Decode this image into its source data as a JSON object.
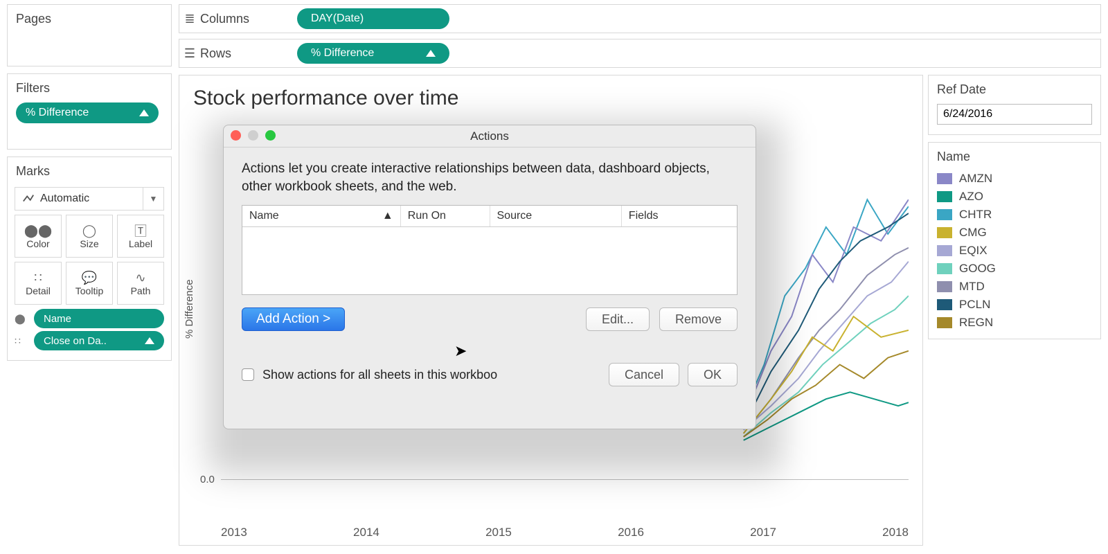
{
  "pages": {
    "title": "Pages"
  },
  "filters": {
    "title": "Filters",
    "pill": "% Difference"
  },
  "marks": {
    "title": "Marks",
    "type": "Automatic",
    "cells": [
      "Color",
      "Size",
      "Label",
      "Detail",
      "Tooltip",
      "Path"
    ],
    "fields": [
      {
        "icon": "color",
        "label": "Name"
      },
      {
        "icon": "detail",
        "label": "Close on Da.."
      }
    ]
  },
  "shelves": {
    "columns": {
      "label": "Columns",
      "pill": "DAY(Date)"
    },
    "rows": {
      "label": "Rows",
      "pill": "% Difference"
    }
  },
  "viz": {
    "title": "Stock performance over time",
    "y_axis": "% Difference",
    "zero_label": "0.0",
    "x_ticks": [
      "2013",
      "2014",
      "2015",
      "2016",
      "2017",
      "2018"
    ]
  },
  "ref": {
    "title": "Ref Date",
    "value": "6/24/2016"
  },
  "legend": {
    "title": "Name",
    "items": [
      {
        "label": "AMZN",
        "color": "#8a87c7"
      },
      {
        "label": "AZO",
        "color": "#0f9984"
      },
      {
        "label": "CHTR",
        "color": "#3aa6c4"
      },
      {
        "label": "CMG",
        "color": "#c9b22f"
      },
      {
        "label": "EQIX",
        "color": "#a6a8d4"
      },
      {
        "label": "GOOG",
        "color": "#6fd1bd"
      },
      {
        "label": "MTD",
        "color": "#8f8fae"
      },
      {
        "label": "PCLN",
        "color": "#1e5a78"
      },
      {
        "label": "REGN",
        "color": "#a5892a"
      }
    ]
  },
  "dialog": {
    "title": "Actions",
    "desc": "Actions let you create interactive relationships between data, dashboard objects, other workbook sheets, and the web.",
    "headers": {
      "name": "Name",
      "run": "Run On",
      "source": "Source",
      "fields": "Fields"
    },
    "add": "Add Action >",
    "edit": "Edit...",
    "remove": "Remove",
    "show_all": "Show actions for all sheets in this workboo",
    "cancel": "Cancel",
    "ok": "OK"
  },
  "chart_data": {
    "type": "line",
    "title": "Stock performance over time",
    "xlabel": "",
    "ylabel": "% Difference",
    "x_range": [
      2012.5,
      2018.5
    ],
    "y_zero": 0.0,
    "note": "Nine overlapping stock % difference series; precise values occluded by dialog.",
    "series": [
      {
        "name": "AMZN",
        "color": "#8a87c7"
      },
      {
        "name": "AZO",
        "color": "#0f9984"
      },
      {
        "name": "CHTR",
        "color": "#3aa6c4"
      },
      {
        "name": "CMG",
        "color": "#c9b22f"
      },
      {
        "name": "EQIX",
        "color": "#a6a8d4"
      },
      {
        "name": "GOOG",
        "color": "#6fd1bd"
      },
      {
        "name": "MTD",
        "color": "#8f8fae"
      },
      {
        "name": "PCLN",
        "color": "#1e5a78"
      },
      {
        "name": "REGN",
        "color": "#a5892a"
      }
    ]
  }
}
